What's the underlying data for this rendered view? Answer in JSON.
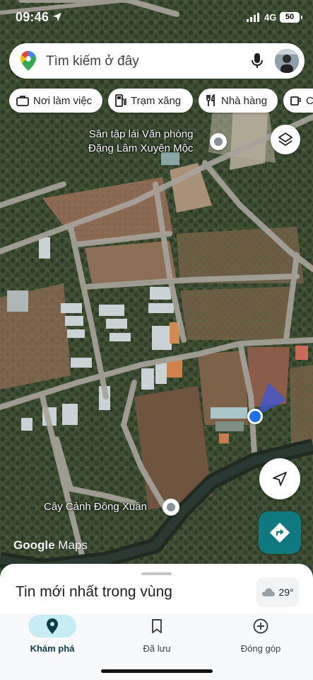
{
  "status_bar": {
    "time": "09:46",
    "network": "4G",
    "battery": "50"
  },
  "search": {
    "placeholder": "Tìm kiếm ở đây"
  },
  "chips": [
    {
      "label": "Nơi làm việc",
      "icon": "briefcase-icon"
    },
    {
      "label": "Trạm xăng",
      "icon": "gas-station-icon"
    },
    {
      "label": "Nhà hàng",
      "icon": "restaurant-icon"
    },
    {
      "label": "C",
      "icon": "coffee-icon"
    }
  ],
  "map": {
    "places": [
      {
        "label_line1": "Sân tập lái Văn phòng",
        "label_line2": "Đặng Lâm Xuyên Mộc"
      },
      {
        "label": "Cây Cảnh Đông Xuân"
      }
    ],
    "watermark_brand": "Google",
    "watermark_product": "Maps"
  },
  "sheet": {
    "title": "Tin mới nhất trong vùng"
  },
  "weather": {
    "temperature": "29°",
    "icon": "cloud-icon"
  },
  "nav": {
    "tabs": [
      {
        "label": "Khám phá",
        "icon": "location-pin-icon",
        "active": true
      },
      {
        "label": "Đã lưu",
        "icon": "bookmark-icon",
        "active": false
      },
      {
        "label": "Đóng góp",
        "icon": "add-circle-icon",
        "active": false
      }
    ]
  },
  "colors": {
    "accent": "#1a73e8",
    "directions": "#0e7a80",
    "active_tab": "#c8ecf3"
  }
}
